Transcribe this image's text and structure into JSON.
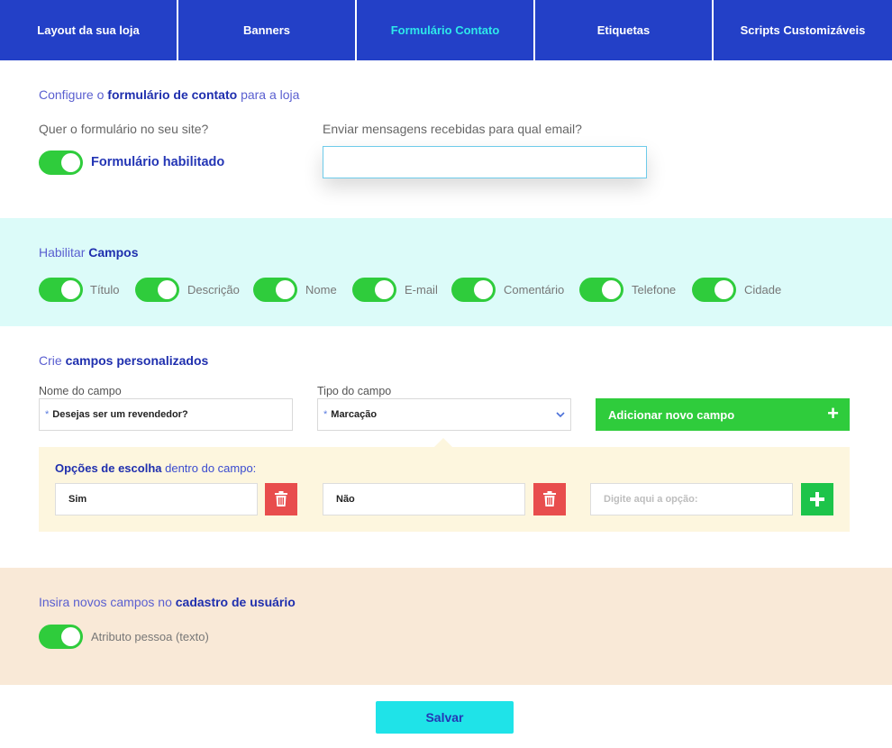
{
  "tabs": [
    {
      "label": "Layout da sua loja",
      "active": false
    },
    {
      "label": "Banners",
      "active": false
    },
    {
      "label": "Formulário Contato",
      "active": true
    },
    {
      "label": "Etiquetas",
      "active": false
    },
    {
      "label": "Scripts Customizáveis",
      "active": false
    }
  ],
  "contact": {
    "title_pre": "Configure o ",
    "title_bold": "formulário de contato",
    "title_post": " para a loja",
    "question": "Quer o formulário no seu site?",
    "toggle_label": "Formulário habilitado",
    "email_label": "Enviar mensagens recebidas para qual email?",
    "email_value": ""
  },
  "fields": {
    "title_pre": "Habilitar ",
    "title_bold": "Campos",
    "items": [
      "Título",
      "Descrição",
      "Nome",
      "E-mail",
      "Comentário",
      "Telefone",
      "Cidade"
    ]
  },
  "custom": {
    "title_pre": "Crie ",
    "title_bold": "campos personalizados",
    "name_label": "Nome do campo",
    "name_value": "Desejas ser um revendedor?",
    "type_label": "Tipo do campo",
    "type_value": "Marcação",
    "add_button": "Adicionar novo campo",
    "options_title_bold": "Opções de escolha",
    "options_title_post": " dentro do campo:",
    "option_1": "Sim",
    "option_2": "Não",
    "option_placeholder": "Digite aqui a opção:"
  },
  "register": {
    "title_pre": "Insira novos campos no ",
    "title_bold": "cadastro de usuário",
    "toggle_label": "Atributo pessoa (texto)"
  },
  "save_label": "Salvar",
  "colors": {
    "tab_bg": "#2340c7",
    "tab_active_text": "#2ee8ea",
    "toggle_on": "#2fcc3c",
    "fields_bg": "#dcfbf9",
    "options_bg": "#fdf6de",
    "register_bg": "#f9e9d7",
    "delete_red": "#e84d4d",
    "save_bg": "#1fe3e8"
  }
}
